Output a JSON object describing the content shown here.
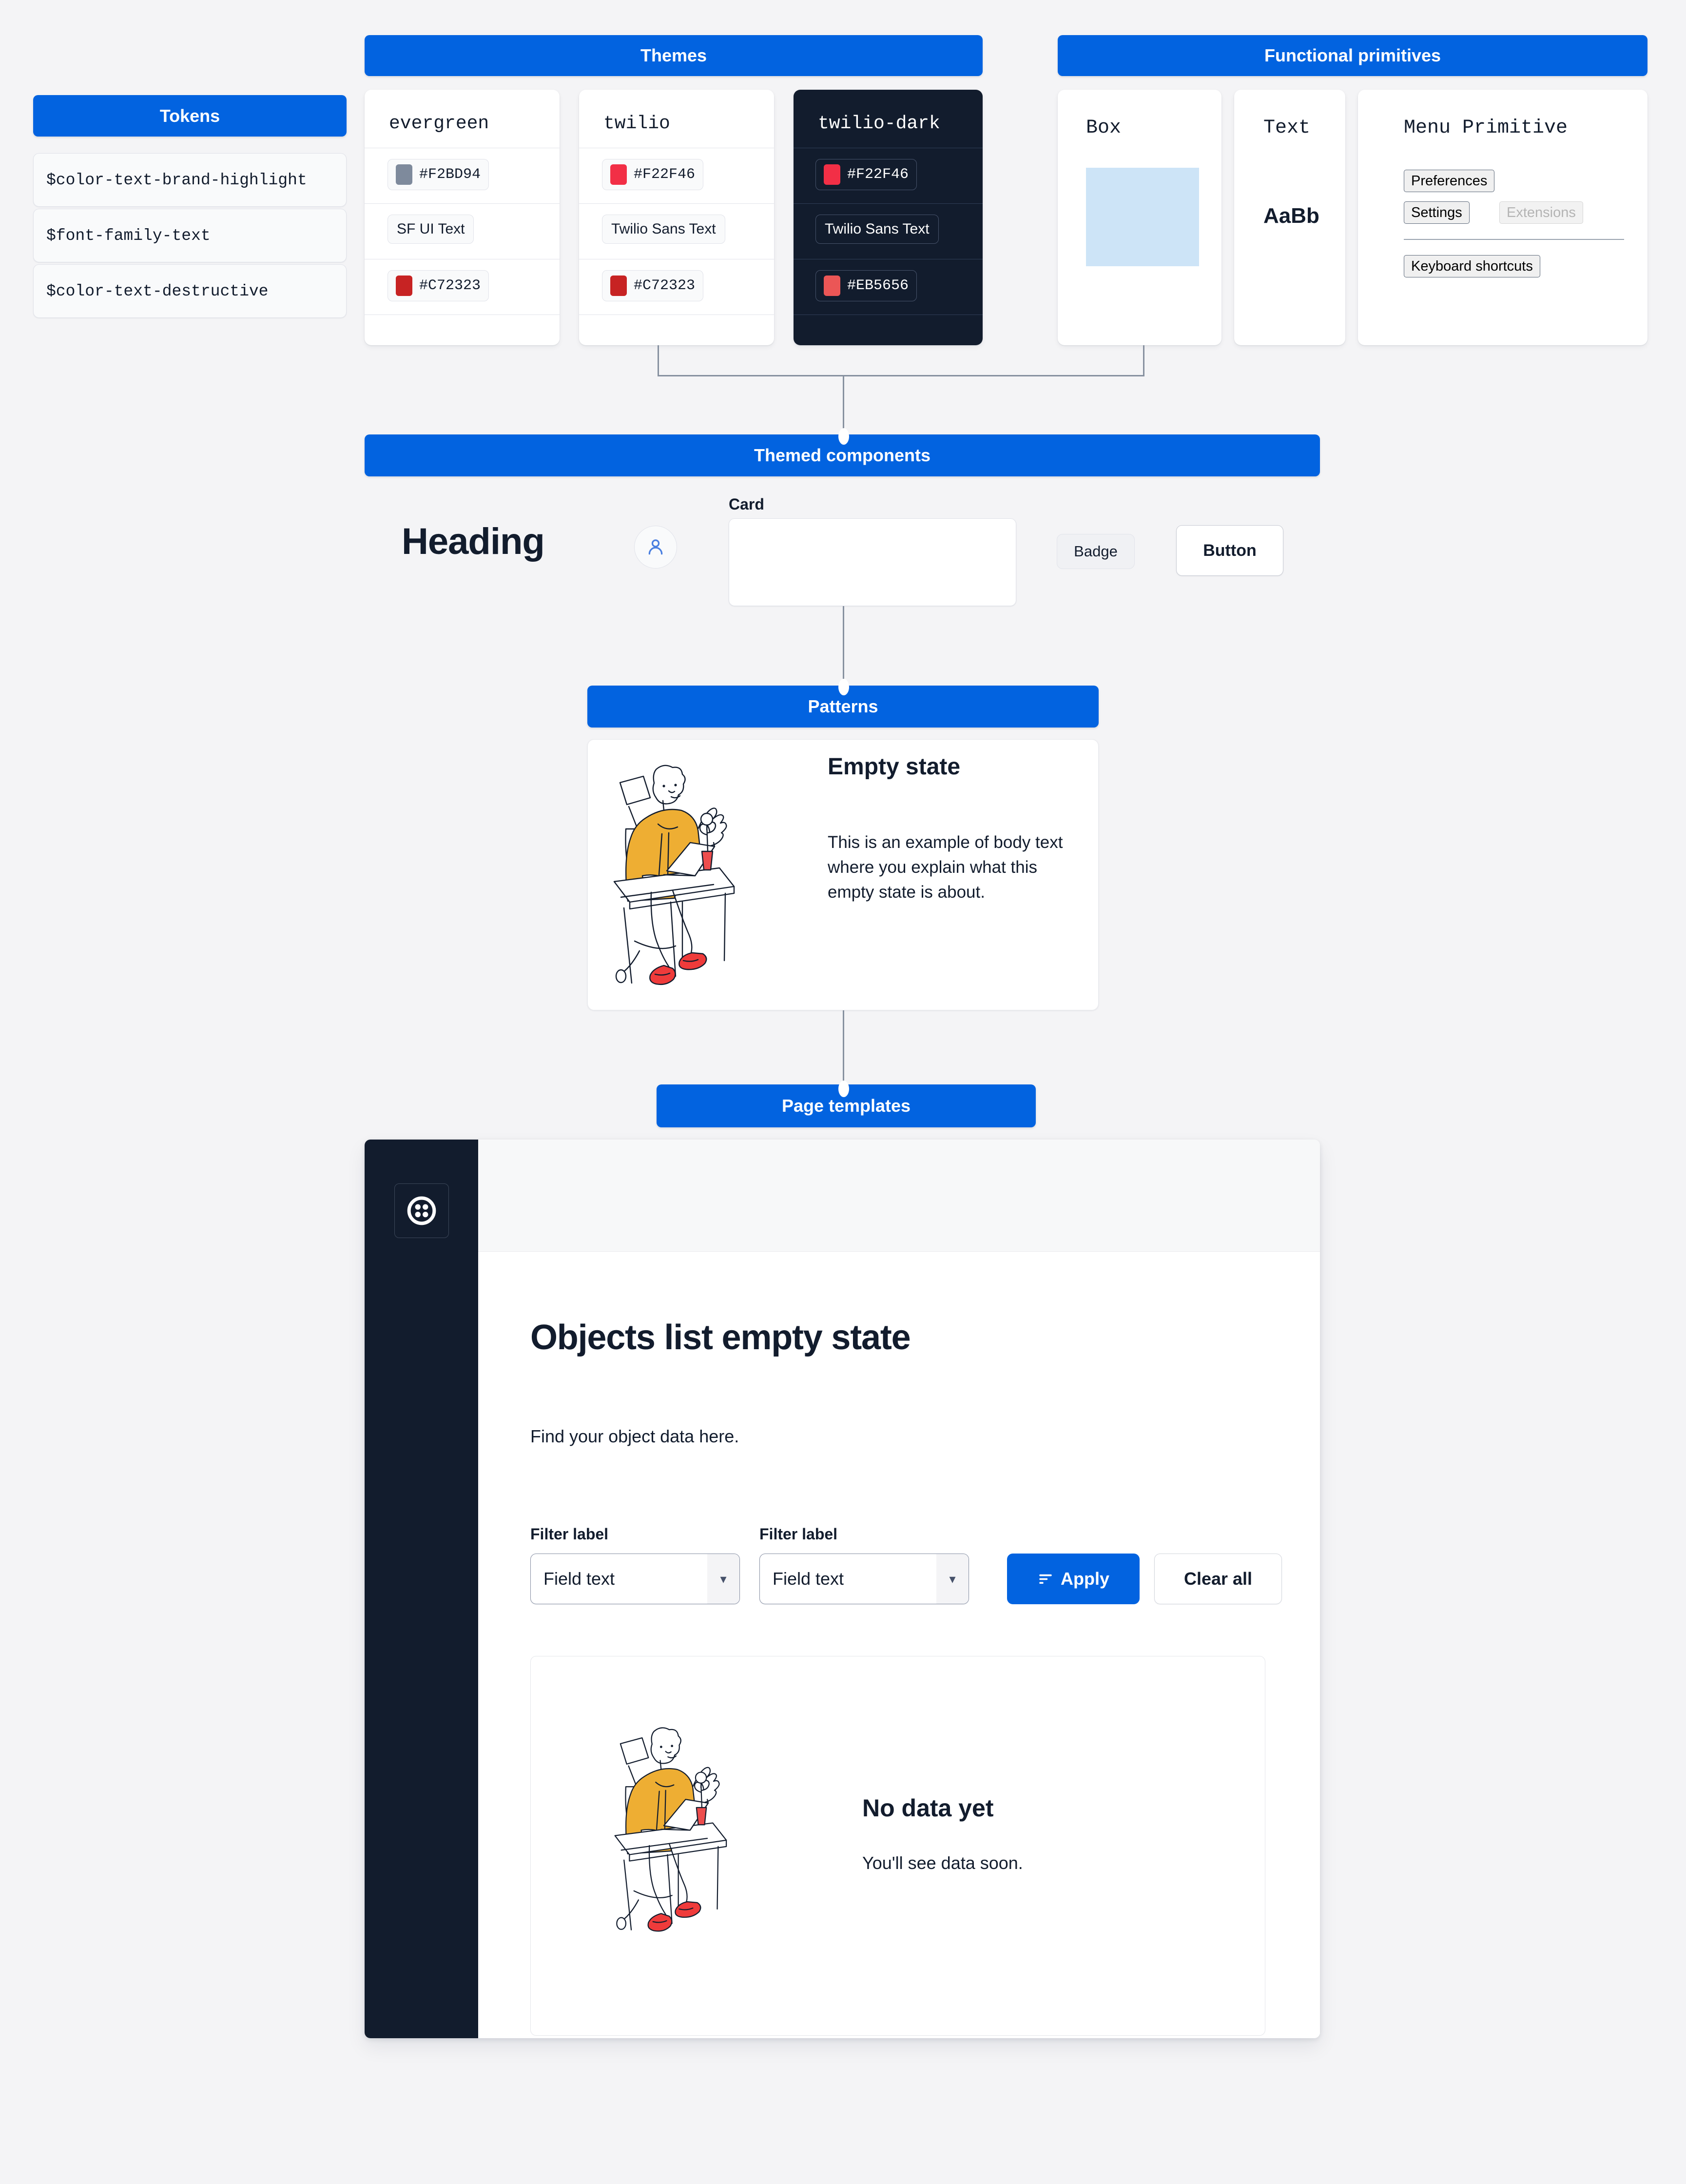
{
  "sections": {
    "tokens": "Tokens",
    "themes": "Themes",
    "functional_primitives": "Functional primitives",
    "themed_components": "Themed components",
    "patterns": "Patterns",
    "page_templates": "Page templates"
  },
  "tokens": {
    "rows": [
      {
        "name": "$color-text-brand-highlight"
      },
      {
        "name": "$font-family-text"
      },
      {
        "name": "$color-text-destructive"
      }
    ]
  },
  "themes": {
    "columns": [
      {
        "name": "evergreen",
        "dark": false,
        "values": [
          {
            "kind": "color",
            "label": "#F2BD94",
            "swatch": "#7e8a9c"
          },
          {
            "kind": "font",
            "label": "SF UI Text"
          },
          {
            "kind": "color",
            "label": "#C72323",
            "swatch": "#c72323"
          }
        ]
      },
      {
        "name": "twilio",
        "dark": false,
        "values": [
          {
            "kind": "color",
            "label": "#F22F46",
            "swatch": "#f22f46"
          },
          {
            "kind": "font",
            "label": "Twilio Sans Text"
          },
          {
            "kind": "color",
            "label": "#C72323",
            "swatch": "#c72323"
          }
        ]
      },
      {
        "name": "twilio-dark",
        "dark": true,
        "values": [
          {
            "kind": "color",
            "label": "#F22F46",
            "swatch": "#f22f46"
          },
          {
            "kind": "font",
            "label": "Twilio Sans Text"
          },
          {
            "kind": "color",
            "label": "#EB5656",
            "swatch": "#eb5656"
          }
        ]
      }
    ]
  },
  "primitives": {
    "box": {
      "title": "Box",
      "fill": "#cde4f7"
    },
    "text": {
      "title": "Text",
      "sample": "AaBb"
    },
    "menu": {
      "title": "Menu Primitive",
      "items": [
        "Preferences",
        "Settings",
        "Extensions",
        "Keyboard shortcuts"
      ],
      "disabled_item": "Extensions"
    }
  },
  "themed_components": {
    "heading": "Heading",
    "avatar_icon": "user-icon",
    "card_label": "Card",
    "badge": "Badge",
    "button": "Button"
  },
  "pattern": {
    "title": "Empty state",
    "body": "This is an example of body text where you explain what this empty state is about."
  },
  "app": {
    "logo_icon": "twilio-logo-icon",
    "page_title": "Objects list empty state",
    "page_subtitle": "Find your object data here.",
    "filters": [
      {
        "label": "Filter label",
        "value": "Field text",
        "caret": "chevron-down-icon"
      },
      {
        "label": "Filter label",
        "value": "Field text",
        "caret": "chevron-down-icon"
      }
    ],
    "apply_button": {
      "label": "Apply",
      "icon": "filter-icon"
    },
    "clear_button": {
      "label": "Clear all"
    },
    "empty_state": {
      "title": "No data yet",
      "subtitle": "You'll see data soon."
    }
  },
  "colors": {
    "accent": "#0263e0",
    "dark": "#121c2d",
    "page_bg": "#f4f4f6",
    "destructive_evergreen": "#c72323",
    "brand_red": "#f22f46"
  }
}
